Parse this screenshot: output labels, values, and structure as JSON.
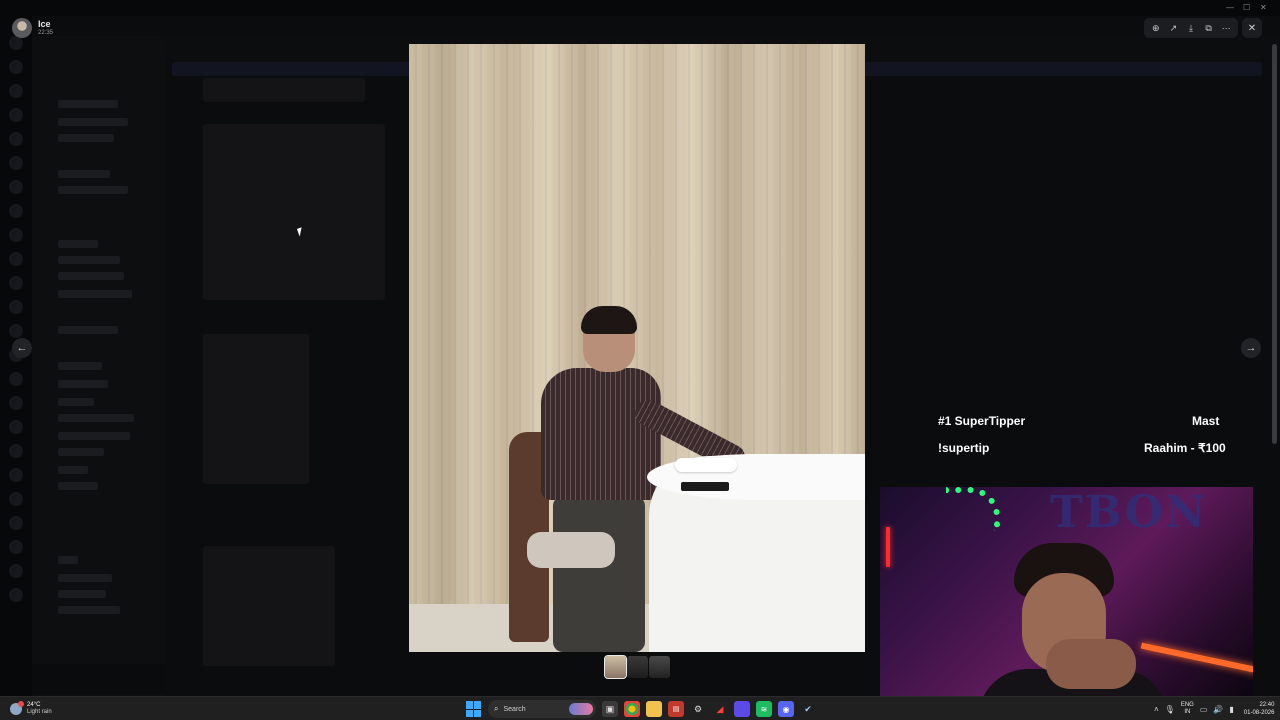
{
  "viewer": {
    "user_name": "Ice",
    "user_time": "22:35",
    "tools": [
      {
        "icon": "zoom-in-icon",
        "glyph": "⊕"
      },
      {
        "icon": "forward-icon",
        "glyph": "↗"
      },
      {
        "icon": "download-icon",
        "glyph": "⤓"
      },
      {
        "icon": "open-external-icon",
        "glyph": "⧉"
      },
      {
        "icon": "more-icon",
        "glyph": "⋯"
      }
    ],
    "close_glyph": "✕",
    "prev_glyph": "←",
    "next_glyph": "→"
  },
  "overlay": {
    "rank_label": "#1 SuperTipper",
    "rank_name": "Mast",
    "command": "!supertip",
    "tip_info": "Raahim - ₹100"
  },
  "taskbar": {
    "weather_temp": "24°C",
    "weather_desc": "Light rain",
    "search_label": "Search",
    "lang_primary": "ENG",
    "lang_region": "IN",
    "clock_time": "22:40",
    "clock_date": "01-08-2026"
  },
  "colors": {
    "accent_blue": "#3ea8ff",
    "overlay_text": "#ffffff",
    "taskbar_bg": "#202020"
  }
}
